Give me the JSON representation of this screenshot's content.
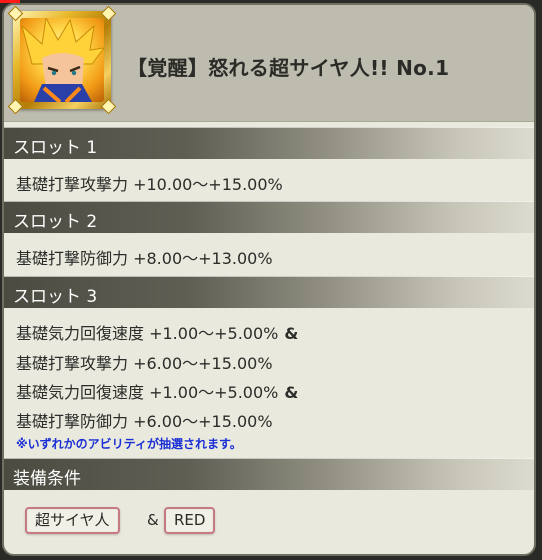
{
  "item": {
    "title": "【覚醒】怒れる超サイヤ人!! No.1",
    "portrait_icon": "super-saiyan-portrait"
  },
  "slots": [
    {
      "header": "スロット 1",
      "lines": [
        "基礎打撃攻撃力 +10.00〜+15.00%"
      ]
    },
    {
      "header": "スロット 2",
      "lines": [
        "基礎打撃防御力 +8.00〜+13.00%"
      ]
    },
    {
      "header": "スロット 3",
      "lines": [
        "基礎気力回復速度 +1.00〜+5.00%",
        "基礎打撃攻撃力 +6.00〜+15.00%",
        "基礎気力回復速度 +1.00〜+5.00%",
        "基礎打撃防御力 +6.00〜+15.00%"
      ],
      "connector": "&",
      "note": "※いずれかのアビリティが抽選されます。"
    }
  ],
  "equip": {
    "header": "装備条件",
    "tags": [
      "超サイヤ人",
      "RED"
    ],
    "connector": "&"
  },
  "colors": {
    "note_text": "#1a2fd6",
    "tag_border": "#c77a82",
    "frame_gold": "#e8b72a"
  }
}
